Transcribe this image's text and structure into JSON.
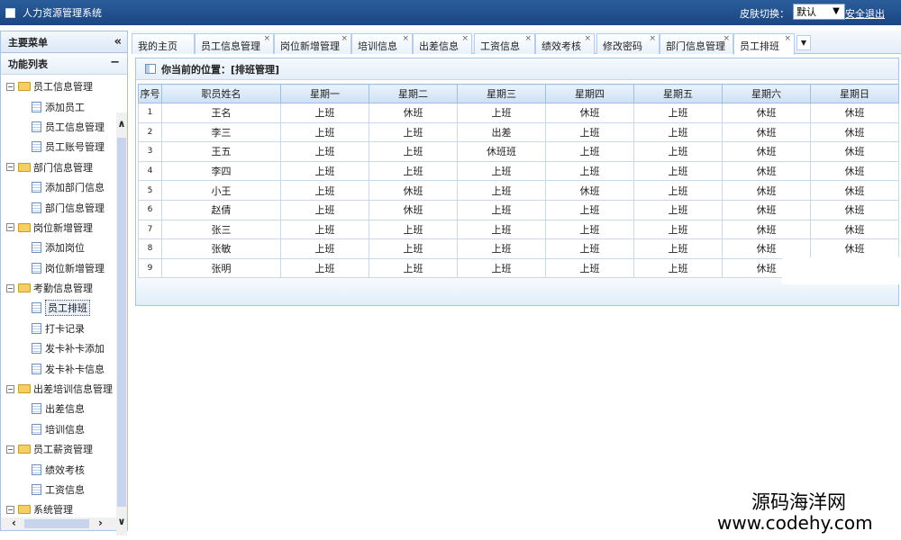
{
  "app": {
    "title": "人力资源管理系统",
    "skin_label": "皮肤切换：",
    "skin_value": "默认",
    "logout": "安全退出"
  },
  "sidebar": {
    "main_menu": "主要菜单",
    "collapse_icon": "«",
    "function_list": "功能列表",
    "groups": [
      {
        "label": "员工信息管理",
        "items": [
          "添加员工",
          "员工信息管理",
          "员工账号管理"
        ]
      },
      {
        "label": "部门信息管理",
        "items": [
          "添加部门信息",
          "部门信息管理"
        ]
      },
      {
        "label": "岗位新增管理",
        "items": [
          "添加岗位",
          "岗位新增管理"
        ]
      },
      {
        "label": "考勤信息管理",
        "items": [
          "员工排班",
          "打卡记录",
          "发卡补卡添加",
          "发卡补卡信息"
        ]
      },
      {
        "label": "出差培训信息管理",
        "items": [
          "出差信息",
          "培训信息"
        ]
      },
      {
        "label": "员工薪资管理",
        "items": [
          "绩效考核",
          "工资信息"
        ]
      },
      {
        "label": "系统管理",
        "items": []
      }
    ]
  },
  "tabs": [
    {
      "label": "我的主页",
      "closable": false
    },
    {
      "label": "员工信息管理",
      "closable": true
    },
    {
      "label": "岗位新增管理",
      "closable": true
    },
    {
      "label": "培训信息",
      "closable": true
    },
    {
      "label": "出差信息",
      "closable": true
    },
    {
      "label": "工资信息",
      "closable": true
    },
    {
      "label": "绩效考核",
      "closable": true
    },
    {
      "label": "修改密码",
      "closable": true
    },
    {
      "label": "部门信息管理",
      "closable": true
    },
    {
      "label": "员工排班",
      "closable": true,
      "active": true
    }
  ],
  "breadcrumb": "你当前的位置：[排班管理]",
  "table": {
    "headers": [
      "序号",
      "职员姓名",
      "星期一",
      "星期二",
      "星期三",
      "星期四",
      "星期五",
      "星期六",
      "星期日"
    ],
    "rows": [
      [
        "1",
        "王名",
        "上班",
        "休班",
        "上班",
        "休班",
        "上班",
        "休班",
        "休班"
      ],
      [
        "2",
        "李三",
        "上班",
        "上班",
        "出差",
        "上班",
        "上班",
        "休班",
        "休班"
      ],
      [
        "3",
        "王五",
        "上班",
        "上班",
        "休班班",
        "上班",
        "上班",
        "休班",
        "休班"
      ],
      [
        "4",
        "李四",
        "上班",
        "上班",
        "上班",
        "上班",
        "上班",
        "休班",
        "休班"
      ],
      [
        "5",
        "小王",
        "上班",
        "休班",
        "上班",
        "休班",
        "上班",
        "休班",
        "休班"
      ],
      [
        "6",
        "赵倩",
        "上班",
        "休班",
        "上班",
        "上班",
        "上班",
        "休班",
        "休班"
      ],
      [
        "7",
        "张三",
        "上班",
        "上班",
        "上班",
        "上班",
        "上班",
        "休班",
        "休班"
      ],
      [
        "8",
        "张敏",
        "上班",
        "上班",
        "上班",
        "上班",
        "上班",
        "休班",
        "休班"
      ],
      [
        "9",
        "张明",
        "上班",
        "上班",
        "上班",
        "上班",
        "上班",
        "休班",
        ""
      ]
    ]
  },
  "watermark": {
    "name": "源码海洋网",
    "url": "www.codehy.com"
  }
}
